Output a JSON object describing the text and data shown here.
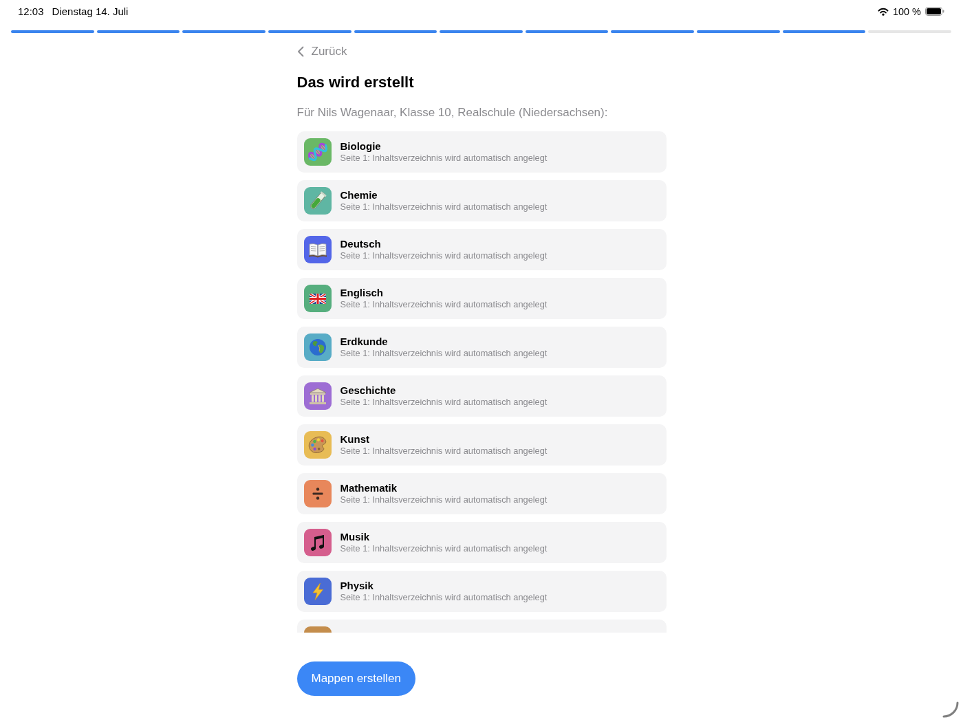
{
  "status_bar": {
    "time": "12:03",
    "date": "Dienstag 14. Juli",
    "battery": "100 %"
  },
  "progress_steps": [
    {
      "done": true
    },
    {
      "done": true
    },
    {
      "done": true
    },
    {
      "done": true
    },
    {
      "done": true
    },
    {
      "done": true
    },
    {
      "done": true
    },
    {
      "done": true
    },
    {
      "done": true
    },
    {
      "done": true
    },
    {
      "done": false
    }
  ],
  "back_button": {
    "label": "Zurück"
  },
  "title": "Das wird erstellt",
  "subtitle": "Für Nils Wagenaar, Klasse 10, Realschule (Niedersachsen):",
  "subjects": [
    {
      "name": "Biologie",
      "detail": "Seite 1: Inhaltsverzeichnis wird automatisch angelegt",
      "kind": "dna",
      "color": "#6ab866",
      "cut_off": false
    },
    {
      "name": "Chemie",
      "detail": "Seite 1: Inhaltsverzeichnis wird automatisch angelegt",
      "kind": "testtube",
      "color": "#5fb6a3",
      "cut_off": false
    },
    {
      "name": "Deutsch",
      "detail": "Seite 1: Inhaltsverzeichnis wird automatisch angelegt",
      "kind": "book",
      "color": "#5366e8",
      "cut_off": false
    },
    {
      "name": "Englisch",
      "detail": "Seite 1: Inhaltsverzeichnis wird automatisch angelegt",
      "kind": "flag",
      "color": "#56ae7e",
      "cut_off": false
    },
    {
      "name": "Erdkunde",
      "detail": "Seite 1: Inhaltsverzeichnis wird automatisch angelegt",
      "kind": "globe",
      "color": "#58acc6",
      "cut_off": false
    },
    {
      "name": "Geschichte",
      "detail": "Seite 1: Inhaltsverzeichnis wird automatisch angelegt",
      "kind": "temple",
      "color": "#9d6dd4",
      "cut_off": false
    },
    {
      "name": "Kunst",
      "detail": "Seite 1: Inhaltsverzeichnis wird automatisch angelegt",
      "kind": "palette",
      "color": "#e8bc55",
      "cut_off": false
    },
    {
      "name": "Mathematik",
      "detail": "Seite 1: Inhaltsverzeichnis wird automatisch angelegt",
      "kind": "divide",
      "color": "#e8875b",
      "cut_off": false
    },
    {
      "name": "Musik",
      "detail": "Seite 1: Inhaltsverzeichnis wird automatisch angelegt",
      "kind": "note",
      "color": "#d55e8d",
      "cut_off": false
    },
    {
      "name": "Physik",
      "detail": "Seite 1: Inhaltsverzeichnis wird automatisch angelegt",
      "kind": "bolt",
      "color": "#4a6cd5",
      "cut_off": false
    },
    {
      "color": "#c48d4c",
      "cut_off": true
    }
  ],
  "primary_button": {
    "label": "Mappen erstellen"
  }
}
